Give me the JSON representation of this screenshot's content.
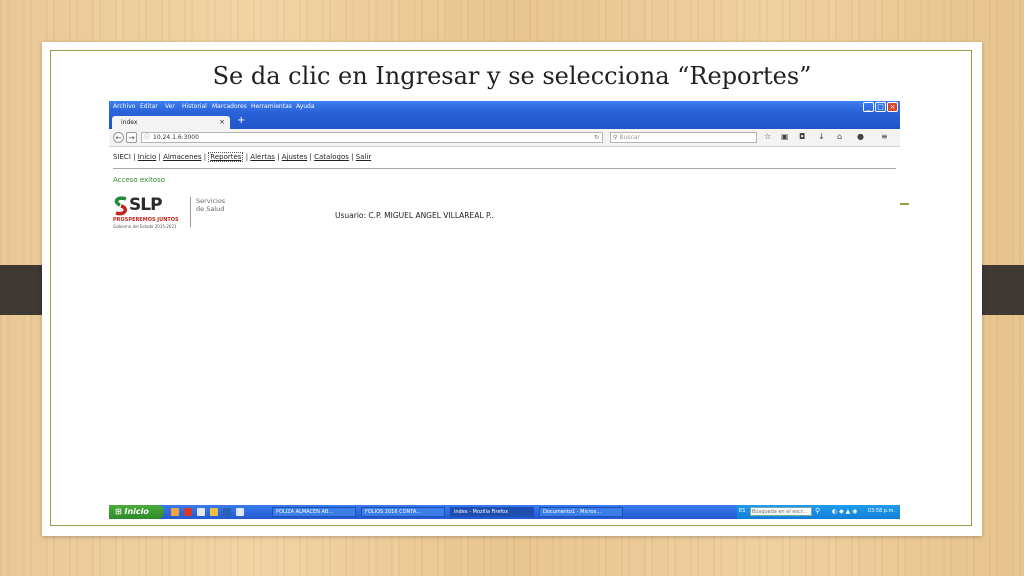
{
  "slide": {
    "title": "Se da clic en Ingresar y se selecciona “Reportes”"
  },
  "browser": {
    "menu": [
      "Archivo",
      "Editar",
      "Ver",
      "Historial",
      "Marcadores",
      "Herramientas",
      "Ayuda"
    ],
    "tab_title": "index",
    "new_tab": "+",
    "tab_close": "×",
    "url": "10.24.1.6:3000",
    "search_placeholder": "Buscar"
  },
  "app": {
    "brand": "SIECI",
    "sep": "|",
    "nav": [
      "Inicio",
      "Almacenes",
      "Reportes",
      "Alertas",
      "Ajustes",
      "Catalogos",
      "Salir"
    ],
    "success_message": "Acceso exitoso",
    "logo": {
      "name": "SLP",
      "tagline": "PROSPEREMOS JUNTOS",
      "subtitle": "Gobierno del Estado 2015-2021",
      "dept_line1": "Servicios",
      "dept_line2": "de Salud"
    },
    "user_label": "Usuario: C.P. MIGUEL ANGEL VILLAREAL P.."
  },
  "taskbar": {
    "start_label": "Inicio",
    "tasks": [
      "POLIZA ALMACEN AB...",
      "FOLIOS 2016 CONTA...",
      "index - Mozilla Firefox",
      "Documento1 - Micros..."
    ],
    "lang": "ES",
    "search_placeholder": "Búsqueda en el escr...",
    "clock": "03:58 p.m."
  }
}
